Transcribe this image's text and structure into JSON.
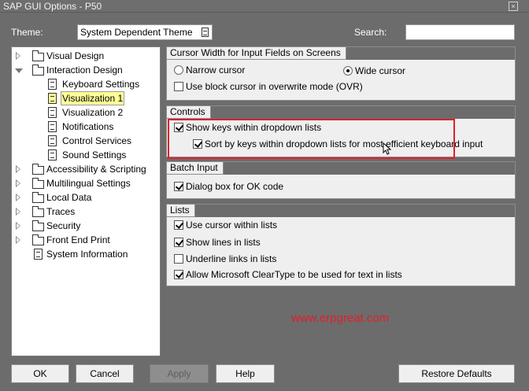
{
  "window": {
    "title": "SAP GUI Options - P50",
    "close_glyph": "×"
  },
  "theme": {
    "label": "Theme:",
    "value": "System Dependent Theme"
  },
  "search": {
    "label": "Search:",
    "value": ""
  },
  "tree": {
    "items": [
      {
        "label": "Visual Design",
        "expander": "closed",
        "icon": "folder-icon",
        "selected": false
      },
      {
        "label": "Interaction Design",
        "expander": "open",
        "icon": "folder-open-icon",
        "selected": false
      },
      {
        "label": "Keyboard Settings",
        "expander": "none",
        "icon": "document-icon",
        "selected": false
      },
      {
        "label": "Visualization 1",
        "expander": "none",
        "icon": "document-icon",
        "selected": true
      },
      {
        "label": "Visualization 2",
        "expander": "none",
        "icon": "document-icon",
        "selected": false
      },
      {
        "label": "Notifications",
        "expander": "none",
        "icon": "document-icon",
        "selected": false
      },
      {
        "label": "Control Services",
        "expander": "none",
        "icon": "document-icon",
        "selected": false
      },
      {
        "label": "Sound Settings",
        "expander": "none",
        "icon": "document-icon",
        "selected": false
      },
      {
        "label": "Accessibility & Scripting",
        "expander": "closed",
        "icon": "folder-icon",
        "selected": false
      },
      {
        "label": "Multilingual Settings",
        "expander": "closed",
        "icon": "folder-icon",
        "selected": false
      },
      {
        "label": "Local Data",
        "expander": "closed",
        "icon": "folder-icon",
        "selected": false
      },
      {
        "label": "Traces",
        "expander": "closed",
        "icon": "folder-icon",
        "selected": false
      },
      {
        "label": "Security",
        "expander": "closed",
        "icon": "folder-icon",
        "selected": false
      },
      {
        "label": "Front End Print",
        "expander": "closed",
        "icon": "folder-icon",
        "selected": false
      },
      {
        "label": "System Information",
        "expander": "none",
        "icon": "document-icon",
        "selected": false
      }
    ]
  },
  "groups": {
    "cursor": {
      "title": "Cursor Width for Input Fields on Screens",
      "narrow": {
        "label": "Narrow cursor",
        "checked": false
      },
      "wide": {
        "label": "Wide cursor",
        "checked": true
      },
      "block": {
        "label": "Use block cursor in overwrite mode (OVR)",
        "checked": false
      }
    },
    "controls": {
      "title": "Controls",
      "show_keys": {
        "label": "Show keys within dropdown lists",
        "checked": true
      },
      "sort_keys": {
        "label": "Sort by keys within dropdown lists for most efficient keyboard input",
        "checked": true
      }
    },
    "batch": {
      "title": "Batch Input",
      "dialog_ok": {
        "label": "Dialog box for OK code",
        "checked": true
      }
    },
    "lists": {
      "title": "Lists",
      "use_cursor": {
        "label": "Use cursor within lists",
        "checked": true
      },
      "show_lines": {
        "label": "Show lines in lists",
        "checked": true
      },
      "underline": {
        "label": "Underline links in lists",
        "checked": false
      },
      "cleartype": {
        "label": "Allow Microsoft ClearType to be used for text in lists",
        "checked": true
      }
    }
  },
  "watermark": "www.erpgreat.com",
  "buttons": {
    "ok": "OK",
    "cancel": "Cancel",
    "apply": "Apply",
    "help": "Help",
    "restore": "Restore Defaults"
  },
  "colors": {
    "highlight": "#e0202a",
    "selected_bg": "#ffff99"
  }
}
